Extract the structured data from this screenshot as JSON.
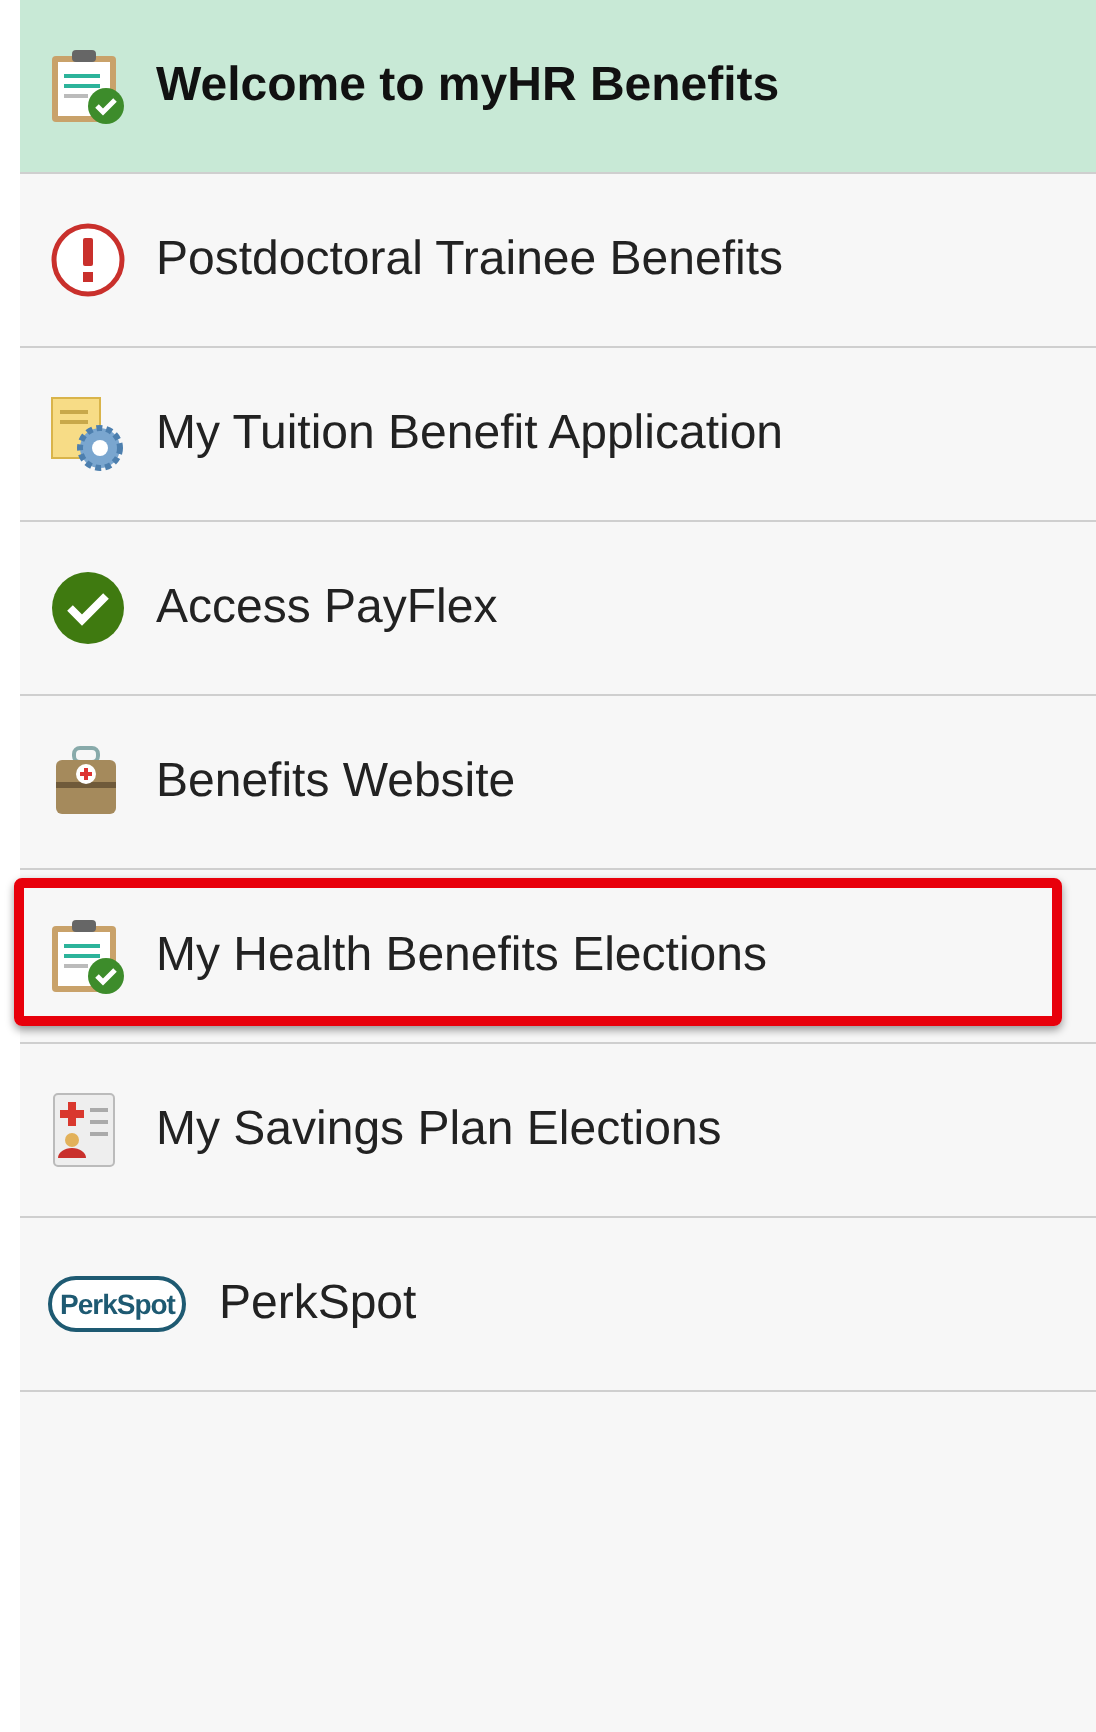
{
  "menu": {
    "items": [
      {
        "label": "Welcome to myHR Benefits",
        "kind": "clipboard",
        "selected": true,
        "highlighted": false
      },
      {
        "label": "Postdoctoral Trainee Benefits",
        "kind": "alert",
        "selected": false,
        "highlighted": false
      },
      {
        "label": "My Tuition Benefit Application",
        "kind": "document",
        "selected": false,
        "highlighted": false
      },
      {
        "label": "Access PayFlex",
        "kind": "check",
        "selected": false,
        "highlighted": false
      },
      {
        "label": "Benefits Website",
        "kind": "bag",
        "selected": false,
        "highlighted": false
      },
      {
        "label": "My Health Benefits Elections",
        "kind": "clipboard",
        "selected": false,
        "highlighted": true
      },
      {
        "label": "My Savings Plan Elections",
        "kind": "form",
        "selected": false,
        "highlighted": false
      },
      {
        "label": "PerkSpot",
        "kind": "logo",
        "logo_text": "PerkSpot",
        "selected": false,
        "highlighted": false
      }
    ]
  }
}
